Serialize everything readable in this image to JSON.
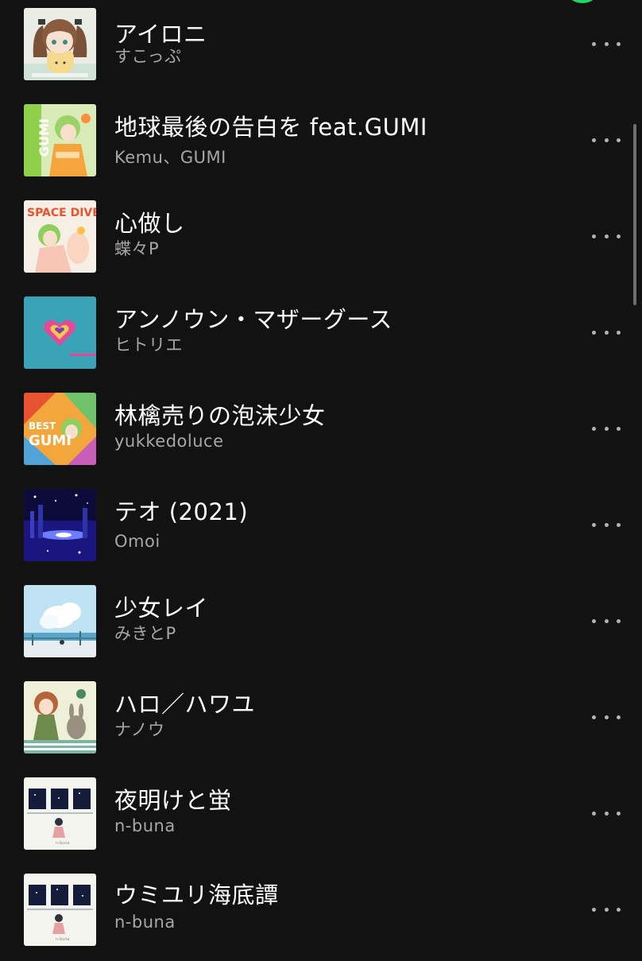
{
  "colors": {
    "background": "#121212",
    "title": "#ffffff",
    "subtitle": "#a7a7a7",
    "accent": "#1ed760"
  },
  "tracks": [
    {
      "title": "アイロニ",
      "artist": "すこっぷ",
      "art_icon": "album-art-ironi"
    },
    {
      "title": "地球最後の告白を feat.GUMI",
      "artist": "Kemu、GUMI",
      "art_icon": "album-art-gumi-ng"
    },
    {
      "title": "心做し",
      "artist": "蝶々P",
      "art_icon": "album-art-space-dive"
    },
    {
      "title": "アンノウン・マザーグース",
      "artist": "ヒトリエ",
      "art_icon": "album-art-heart"
    },
    {
      "title": "林檎売りの泡沫少女",
      "artist": "yukkedoluce",
      "art_icon": "album-art-best-gumi"
    },
    {
      "title": "テオ (2021)",
      "artist": "Omoi",
      "art_icon": "album-art-night-city"
    },
    {
      "title": "少女レイ",
      "artist": "みきとP",
      "art_icon": "album-art-sky"
    },
    {
      "title": "ハロ／ハワユ",
      "artist": "ナノウ",
      "art_icon": "album-art-girl-rabbit"
    },
    {
      "title": "夜明けと蛍",
      "artist": "n-buna",
      "art_icon": "album-art-windows"
    },
    {
      "title": "ウミユリ海底譚",
      "artist": "n-buna",
      "art_icon": "album-art-windows"
    }
  ],
  "more_button_icon": "more-horizontal-icon"
}
